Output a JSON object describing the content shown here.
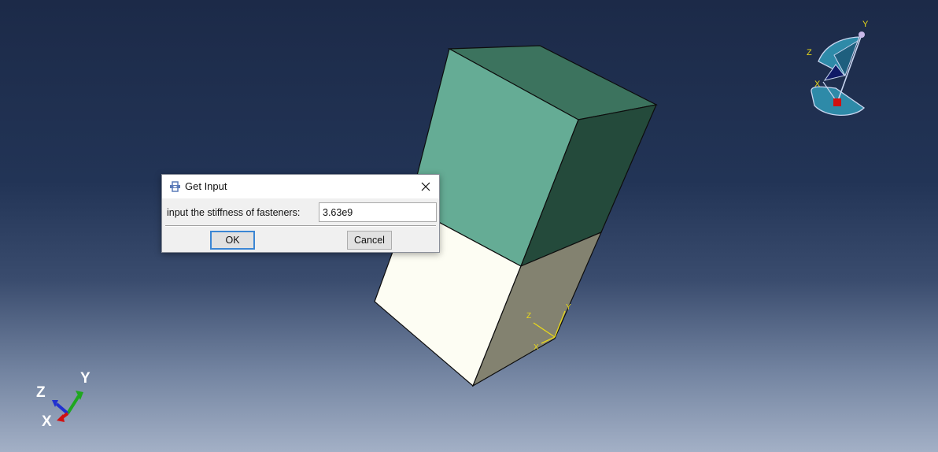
{
  "dialog": {
    "title": "Get Input",
    "field_label": "input the stiffness of fasteners:",
    "field_value": "3.63e9",
    "ok_label": "OK",
    "cancel_label": "Cancel"
  },
  "triad_bottom_left": {
    "x_label": "X",
    "y_label": "Y",
    "z_label": "Z"
  },
  "triad_model": {
    "x_label": "X",
    "y_label": "Y",
    "z_label": "Z"
  },
  "view_cube": {
    "x_label": "X",
    "y_label": "Y",
    "z_label": "Z"
  },
  "colors": {
    "top_block_front": "#65ac95",
    "top_block_side": "#244a3b",
    "top_block_top": "#3c735e",
    "bottom_block_front": "#fdfdf3",
    "bottom_block_side": "#838270",
    "triad_yellow": "#e8d81a",
    "dialog_accent": "#3b86d4"
  }
}
